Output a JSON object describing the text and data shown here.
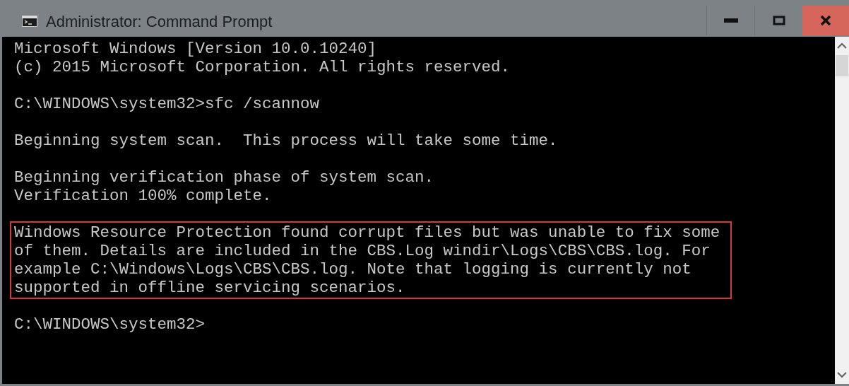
{
  "window": {
    "title": "Administrator: Command Prompt"
  },
  "console": {
    "blocks": [
      {
        "highlighted": false,
        "lines": [
          "Microsoft Windows [Version 10.0.10240]",
          "(c) 2015 Microsoft Corporation. All rights reserved."
        ]
      },
      {
        "highlighted": false,
        "lines": [
          "C:\\WINDOWS\\system32>sfc /scannow"
        ]
      },
      {
        "highlighted": false,
        "lines": [
          "Beginning system scan.  This process will take some time."
        ]
      },
      {
        "highlighted": false,
        "lines": [
          "Beginning verification phase of system scan.",
          "Verification 100% complete."
        ]
      },
      {
        "highlighted": true,
        "lines": [
          "Windows Resource Protection found corrupt files but was unable to fix some",
          "of them. Details are included in the CBS.Log windir\\Logs\\CBS\\CBS.log. For",
          "example C:\\Windows\\Logs\\CBS\\CBS.log. Note that logging is currently not",
          "supported in offline servicing scenarios."
        ]
      },
      {
        "highlighted": false,
        "lines": [
          "C:\\WINDOWS\\system32>"
        ]
      }
    ]
  }
}
